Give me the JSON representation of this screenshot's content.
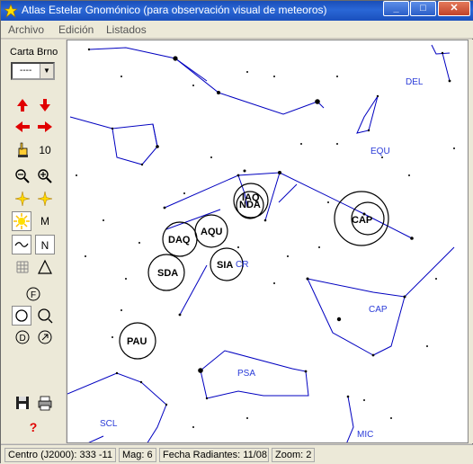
{
  "window": {
    "title": "Atlas Estelar Gnomónico (para observación visual de meteoros)"
  },
  "menu": {
    "items": [
      "Archivo",
      "Edición",
      "Listados"
    ]
  },
  "toolbar": {
    "carta_label": "Carta Brno",
    "carta_value": "----",
    "magnitude_value": "10",
    "m_label": "M",
    "n_label": "N",
    "help_label": "?"
  },
  "chart_data": {
    "type": "other",
    "constellations": [
      "DEL",
      "EQU",
      "CAP",
      "PSA",
      "SCL",
      "MIC",
      "CR"
    ],
    "radiants": [
      "IAQ",
      "NDA",
      "CAP",
      "DAQ",
      "AQU",
      "SDA",
      "SIA",
      "PAU"
    ]
  },
  "status": {
    "centro": "Centro (J2000): 333 -11",
    "mag": "Mag: 6",
    "fecha": "Fecha Radiantes: 11/08",
    "zoom": "Zoom: 2"
  },
  "colors": {
    "line": "#0000c0",
    "label": "#2a3bd8",
    "titlebar": "#1a4eb8"
  }
}
